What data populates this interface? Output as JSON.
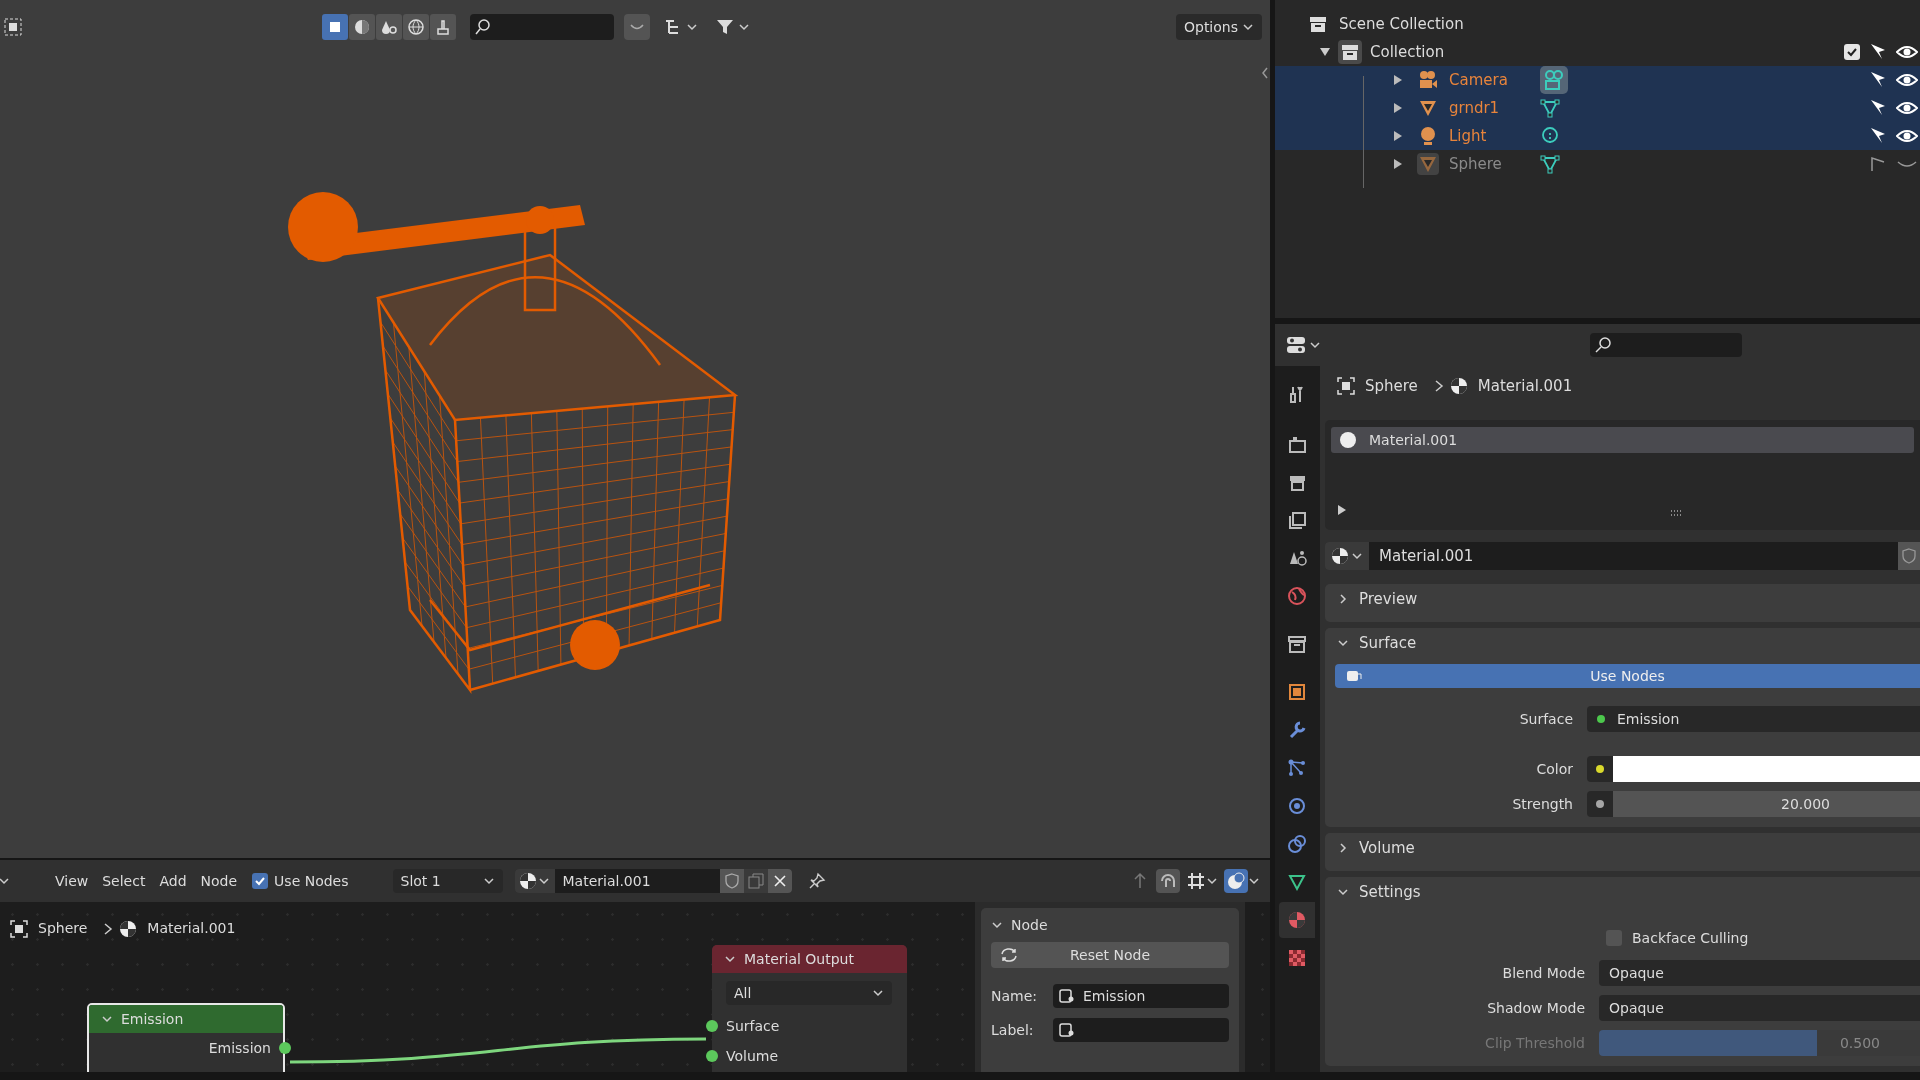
{
  "viewport_header": {
    "toggles": [
      {
        "kind": "box",
        "selected": true
      },
      {
        "kind": "sphere",
        "selected": false
      },
      {
        "kind": "drops",
        "selected": false
      },
      {
        "kind": "globe",
        "selected": false
      },
      {
        "kind": "brush",
        "selected": false
      }
    ],
    "options": "Options"
  },
  "outliner": {
    "items": [
      {
        "label": "Scene Collection",
        "kind": "collection",
        "children": [
          {
            "label": "Collection",
            "kind": "collection",
            "expanded": true,
            "checked": true,
            "children": [
              {
                "label": "Camera",
                "kind": "camera",
                "selected": true,
                "visible": true
              },
              {
                "label": "grndr1",
                "kind": "mesh",
                "selected": true,
                "visible": true
              },
              {
                "label": "Light",
                "kind": "light",
                "selected": true,
                "visible": true
              },
              {
                "label": "Sphere",
                "kind": "mesh",
                "selected": false,
                "visible": false
              }
            ]
          }
        ]
      }
    ]
  },
  "properties": {
    "tabs": [
      {
        "kind": "tool",
        "selected": false
      },
      {
        "kind": "render",
        "selected": false
      },
      {
        "kind": "output",
        "selected": false
      },
      {
        "kind": "view_layer",
        "selected": false
      },
      {
        "kind": "scene",
        "selected": false
      },
      {
        "kind": "world",
        "selected": false
      },
      {
        "kind": "collection",
        "selected": false
      },
      {
        "kind": "object",
        "selected": false
      },
      {
        "kind": "modifier",
        "selected": false
      },
      {
        "kind": "particles",
        "selected": false
      },
      {
        "kind": "physics",
        "selected": false
      },
      {
        "kind": "constraints",
        "selected": false
      },
      {
        "kind": "data",
        "selected": false
      },
      {
        "kind": "material",
        "selected": true
      },
      {
        "kind": "texture",
        "selected": false
      }
    ],
    "breadcrumb": [
      "Sphere",
      "Material.001"
    ],
    "material_slots": [
      {
        "label": "Material.001",
        "selected": true
      }
    ],
    "material": "Material.001",
    "panels": [
      {
        "title": "Preview",
        "expanded": false
      },
      {
        "title": "Surface",
        "expanded": true,
        "button": "Use Nodes",
        "rows": [
          {
            "kind": "socket",
            "label": "Surface",
            "value": "Emission",
            "color": "#4cc84c"
          },
          {
            "kind": "swatch",
            "label": "Color",
            "color": "#d8d82c"
          },
          {
            "kind": "number",
            "label": "Strength",
            "value": "20.000",
            "color": "#a6a6a6"
          }
        ]
      },
      {
        "title": "Volume",
        "expanded": false
      },
      {
        "title": "Settings",
        "expanded": true,
        "rows": [
          {
            "kind": "checkbox",
            "label": "Backface Culling",
            "checked": false
          },
          {
            "kind": "dropdown",
            "label": "Blend Mode",
            "value": "Opaque"
          },
          {
            "kind": "dropdown",
            "label": "Shadow Mode",
            "value": "Opaque"
          },
          {
            "kind": "slider",
            "label": "Clip Threshold",
            "value": "0.500",
            "level": 0.68,
            "disabled": true
          }
        ]
      }
    ]
  },
  "node_editor": {
    "menus": [
      "View",
      "Select",
      "Add",
      "Node"
    ],
    "use_nodes": {
      "label": "Use Nodes",
      "checked": true
    },
    "slot": "Slot 1",
    "material": "Material.001",
    "breadcrumb": [
      "Sphere",
      "Material.001"
    ],
    "nodes": [
      {
        "kind": "emission",
        "title": "Emission",
        "color": "#2f6a2f",
        "outputs": [
          "Emission"
        ]
      },
      {
        "kind": "output",
        "title": "Material Output",
        "color": "#6a2530",
        "target": "All",
        "inputs": [
          "Surface",
          "Volume"
        ]
      }
    ],
    "sidebar": {
      "title": "Node",
      "reset": "Reset Node",
      "name_label": "Name:",
      "name": "Emission",
      "label_label": "Label:"
    }
  }
}
